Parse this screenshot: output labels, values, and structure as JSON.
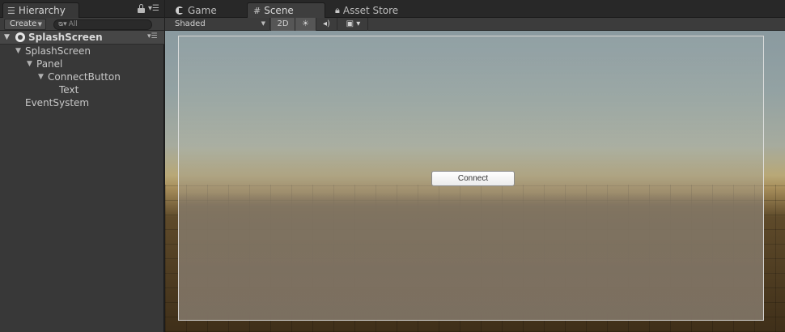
{
  "hierarchy": {
    "tab_label": "Hierarchy",
    "create_label": "Create",
    "search_placeholder": "All",
    "scene_name": "SplashScreen",
    "items": [
      {
        "label": "SplashScreen",
        "depth": 1,
        "expanded": true
      },
      {
        "label": "Panel",
        "depth": 2,
        "expanded": true
      },
      {
        "label": "ConnectButton",
        "depth": 3,
        "expanded": true
      },
      {
        "label": "Text",
        "depth": 4,
        "expanded": false
      },
      {
        "label": "EventSystem",
        "depth": 1,
        "expanded": false
      }
    ]
  },
  "tabs": {
    "game": "Game",
    "scene": "Scene",
    "asset_store": "Asset Store"
  },
  "scene_toolbar": {
    "shading_mode": "Shaded",
    "mode_2d": "2D"
  },
  "viewport": {
    "button_label": "Connect"
  },
  "icons": [
    "hierarchy-list-icon",
    "lock-icon",
    "panel-menu-icon",
    "unity-logo-icon",
    "game-icon",
    "scene-grid-icon",
    "asset-store-icon",
    "sun-icon",
    "audio-icon",
    "image-effects-icon",
    "search-icon",
    "fold-arrow-icon"
  ]
}
